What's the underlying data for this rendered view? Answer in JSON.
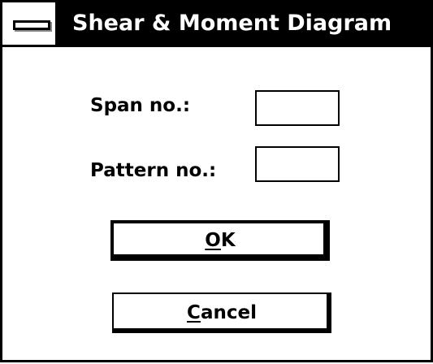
{
  "window": {
    "title": "Shear & Moment Diagram"
  },
  "form": {
    "span_label": "Span no.:",
    "span_value": "",
    "pattern_label": "Pattern no.:",
    "pattern_value": ""
  },
  "buttons": {
    "ok": {
      "mnemonic": "O",
      "rest": "K"
    },
    "cancel": {
      "mnemonic": "C",
      "rest": "ancel"
    }
  }
}
